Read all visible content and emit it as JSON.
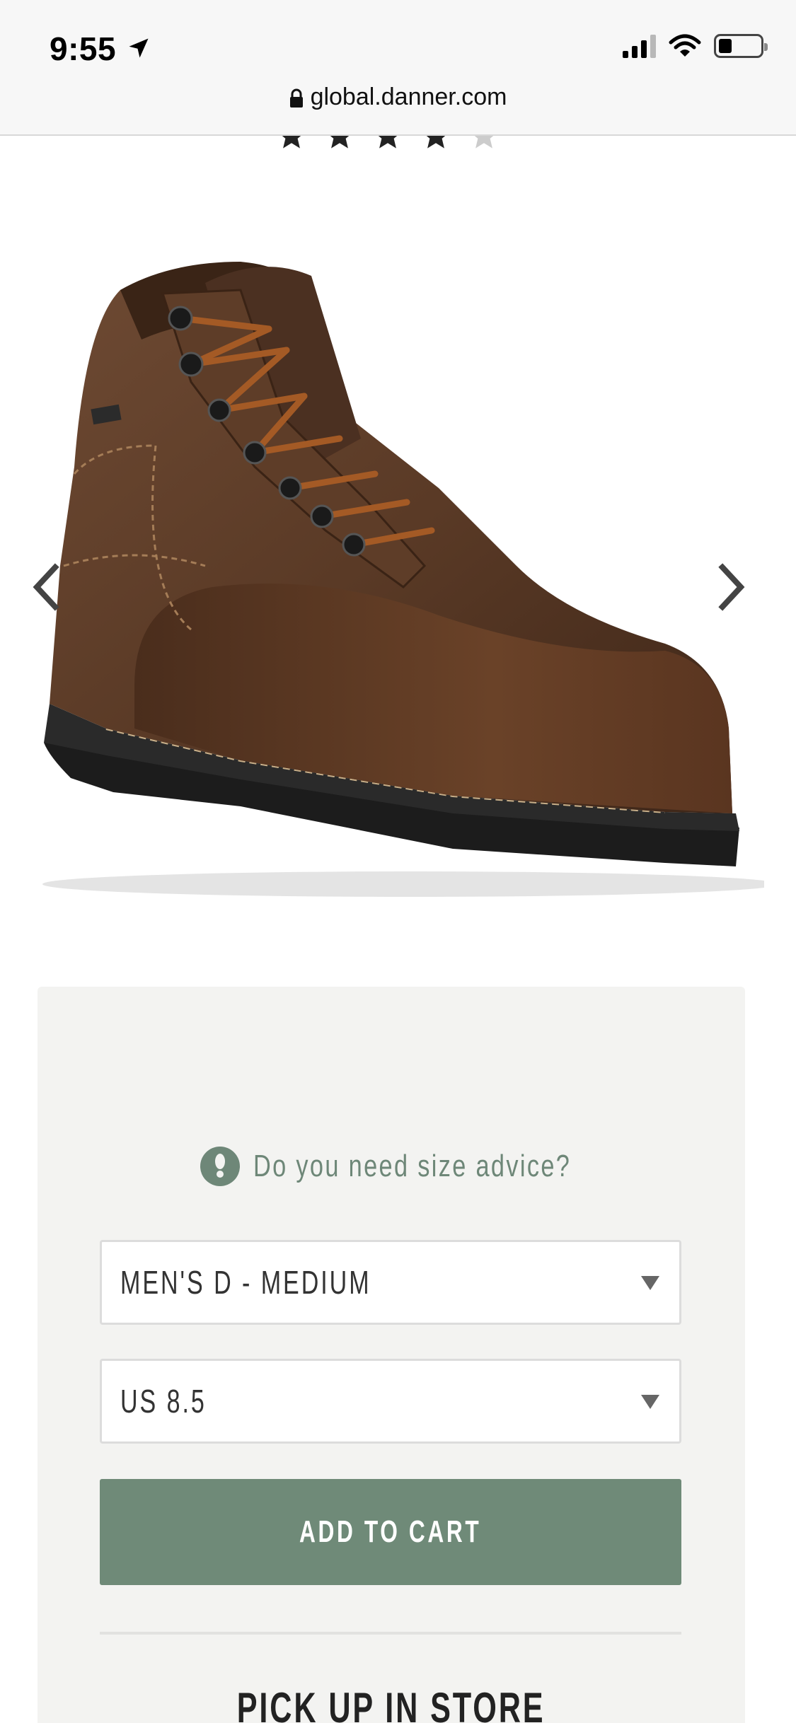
{
  "status_bar": {
    "time": "9:55"
  },
  "browser": {
    "url": "global.danner.com"
  },
  "product": {
    "rating": 4,
    "rating_max": 5
  },
  "purchase": {
    "size_advice": "Do you need size advice?",
    "width_selected": "MEN'S D - MEDIUM",
    "size_selected": "US 8.5",
    "add_to_cart": "ADD TO CART",
    "pickup": "PICK UP IN STORE"
  },
  "colors": {
    "accent": "#6f8a78",
    "panel_bg": "#f3f3f1",
    "star_filled": "#222222",
    "star_empty": "#cccccc"
  },
  "icons": [
    "location-arrow-icon",
    "cell-signal-icon",
    "wifi-icon",
    "battery-icon",
    "lock-icon",
    "star-icon",
    "chevron-left-icon",
    "chevron-right-icon",
    "footprint-icon",
    "dropdown-caret-icon"
  ]
}
